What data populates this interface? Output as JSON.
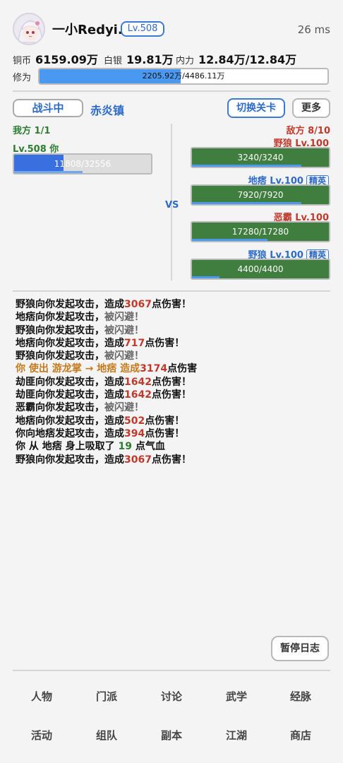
{
  "header": {
    "username": "一小Redyi.",
    "level": "Lv.508",
    "latency": "26 ms"
  },
  "stats": {
    "copper_label": "铜币",
    "copper_value": "6159.09万",
    "silver_label": "白银",
    "silver_value": "19.81万",
    "neili_label": "内力",
    "neili_value": "12.84万/12.84万",
    "cultivation_label": "修为",
    "cultivation_text": "2205.92万/4486.11万",
    "cultivation_progress": 0.49
  },
  "battle": {
    "status_button": "战斗中",
    "location": "赤炎镇",
    "switch_button": "切换关卡",
    "more_button": "更多",
    "vs_label": "VS",
    "ally": {
      "side_label": "我方 1/1",
      "name": "Lv.508 你",
      "hp_text": "11808/32556",
      "hp_progress": 0.363,
      "sub_progress": 0.5
    },
    "enemy": {
      "side_label": "敌方 8/10",
      "units": [
        {
          "name": "野狼 Lv.100",
          "elite": "",
          "color": "red",
          "hp_text": "3240/3240",
          "hp_progress": 1.0,
          "sub_progress": 0.8
        },
        {
          "name": "地痞 Lv.100",
          "elite": "精英",
          "color": "blue",
          "hp_text": "7920/7920",
          "hp_progress": 1.0,
          "sub_progress": 0.8
        },
        {
          "name": "恶霸 Lv.100",
          "elite": "",
          "color": "red",
          "hp_text": "17280/17280",
          "hp_progress": 1.0,
          "sub_progress": 0.55
        },
        {
          "name": "野狼 Lv.100",
          "elite": "精英",
          "color": "blue",
          "hp_text": "4400/4400",
          "hp_progress": 1.0,
          "sub_progress": 0.2
        }
      ]
    }
  },
  "log": [
    [
      {
        "t": "野狼向你发起攻击，造成",
        "c": ""
      },
      {
        "t": "3067",
        "c": "dmg"
      },
      {
        "t": "点伤害！",
        "c": ""
      }
    ],
    [
      {
        "t": "地痞向你发起攻击，",
        "c": ""
      },
      {
        "t": "被闪避！",
        "c": "dodge"
      }
    ],
    [
      {
        "t": "野狼向你发起攻击，",
        "c": ""
      },
      {
        "t": "被闪避！",
        "c": "dodge"
      }
    ],
    [
      {
        "t": "地痞向你发起攻击，造成",
        "c": ""
      },
      {
        "t": "717",
        "c": "dmg"
      },
      {
        "t": "点伤害！",
        "c": ""
      }
    ],
    [
      {
        "t": "野狼向你发起攻击，",
        "c": ""
      },
      {
        "t": "被闪避！",
        "c": "dodge"
      }
    ],
    [
      {
        "t": "你 使出 游龙掌 → 地痞 造成",
        "c": "skill"
      },
      {
        "t": "3174",
        "c": "dmg"
      },
      {
        "t": "点伤害",
        "c": ""
      }
    ],
    [
      {
        "t": "劫匪向你发起攻击，造成",
        "c": ""
      },
      {
        "t": "1642",
        "c": "dmg"
      },
      {
        "t": "点伤害！",
        "c": ""
      }
    ],
    [
      {
        "t": "劫匪向你发起攻击，造成",
        "c": ""
      },
      {
        "t": "1642",
        "c": "dmg"
      },
      {
        "t": "点伤害！",
        "c": ""
      }
    ],
    [
      {
        "t": "恶霸向你发起攻击，",
        "c": ""
      },
      {
        "t": "被闪避！",
        "c": "dodge"
      }
    ],
    [
      {
        "t": "地痞向你发起攻击，造成",
        "c": ""
      },
      {
        "t": "502",
        "c": "dmg"
      },
      {
        "t": "点伤害！",
        "c": ""
      }
    ],
    [
      {
        "t": "你向地痞发起攻击，造成",
        "c": ""
      },
      {
        "t": "394",
        "c": "dmg"
      },
      {
        "t": "点伤害！",
        "c": ""
      }
    ],
    [
      {
        "t": "你 从 地痞 身上吸取了 ",
        "c": ""
      },
      {
        "t": "19",
        "c": "heal"
      },
      {
        "t": " 点气血",
        "c": ""
      }
    ],
    [
      {
        "t": "野狼向你发起攻击，造成",
        "c": ""
      },
      {
        "t": "3067",
        "c": "dmg"
      },
      {
        "t": "点伤害！",
        "c": ""
      }
    ]
  ],
  "pause_button": "暂停日志",
  "nav": {
    "row1": [
      "人物",
      "门派",
      "讨论",
      "武学",
      "经脉"
    ],
    "row2": [
      "活动",
      "组队",
      "副本",
      "江湖",
      "商店"
    ]
  },
  "colors": {
    "accent_blue": "#2d6bc9",
    "hp_green": "#3f7e3f",
    "hp_ally_blue": "#3a6fe0",
    "damage_red": "#c0392b"
  }
}
